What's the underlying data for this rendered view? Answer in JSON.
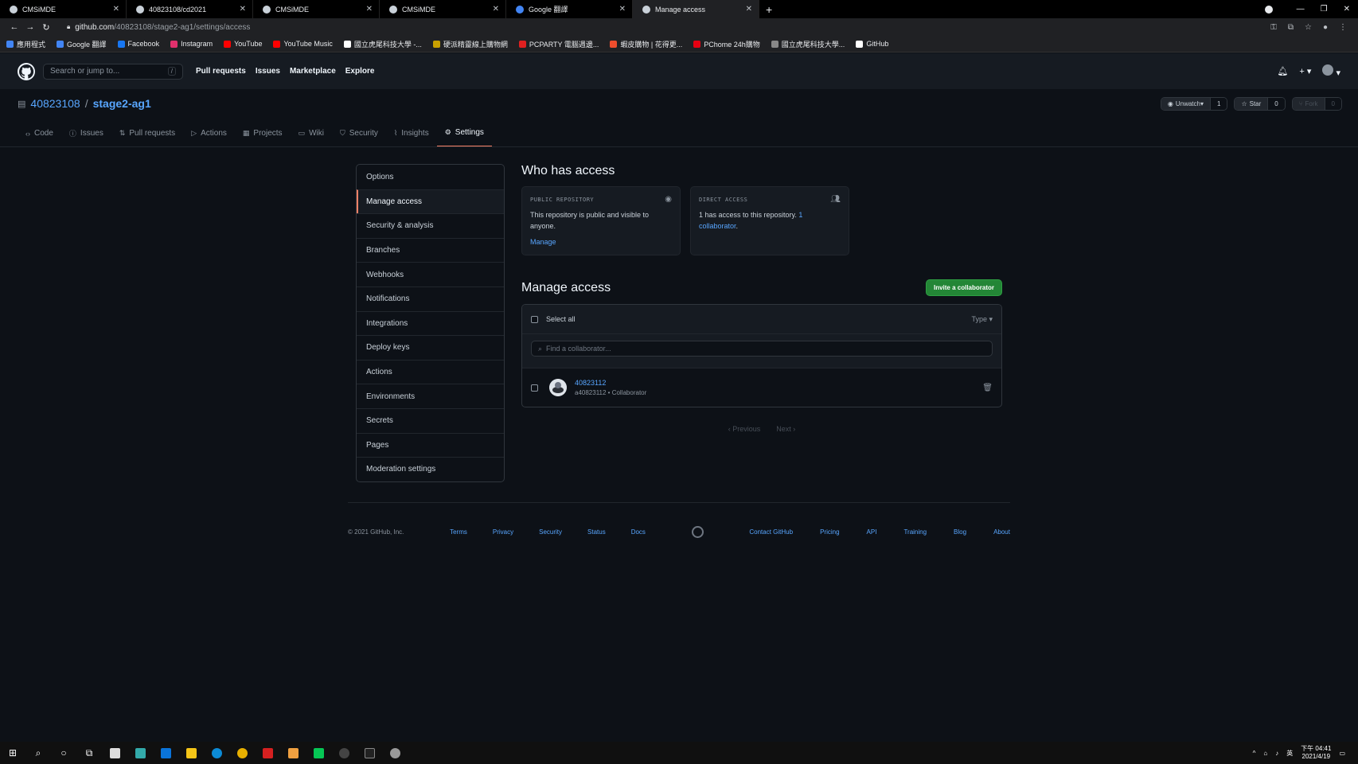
{
  "browser": {
    "tabs": [
      {
        "title": "CMSiMDE",
        "active": false
      },
      {
        "title": "40823108/cd2021",
        "active": false
      },
      {
        "title": "CMSiMDE",
        "active": false
      },
      {
        "title": "CMSiMDE",
        "active": false
      },
      {
        "title": "Google 翻譯",
        "active": false
      },
      {
        "title": "Manage access",
        "active": true
      }
    ],
    "new_tab": "+",
    "url_host": "github.com",
    "url_path": "/40823108/stage2-ag1/settings/access",
    "bookmarks": [
      {
        "label": "應用程式",
        "color": "#4285f4"
      },
      {
        "label": "Google 翻譯",
        "color": "#4285f4"
      },
      {
        "label": "Facebook",
        "color": "#1877f2"
      },
      {
        "label": "Instagram",
        "color": "#e1306c"
      },
      {
        "label": "YouTube",
        "color": "#ff0000"
      },
      {
        "label": "YouTube Music",
        "color": "#ff0000"
      },
      {
        "label": "國立虎尾科技大學 -...",
        "color": "#ffffff"
      },
      {
        "label": "硬派精靈線上購物網",
        "color": "#c8a000"
      },
      {
        "label": "PCPARTY 電腦週邊...",
        "color": "#e02020"
      },
      {
        "label": "蝦皮購物 | 花得更...",
        "color": "#ee4d2d"
      },
      {
        "label": "PChome 24h購物",
        "color": "#e60012"
      },
      {
        "label": "國立虎尾科技大學...",
        "color": "#888888"
      },
      {
        "label": "GitHub",
        "color": "#ffffff"
      }
    ]
  },
  "gh": {
    "search_placeholder": "Search or jump to...",
    "slash": "/",
    "nav": [
      "Pull requests",
      "Issues",
      "Marketplace",
      "Explore"
    ],
    "owner": "40823108",
    "repo": "stage2-ag1",
    "repo_sep": "/",
    "unwatch": "Unwatch",
    "unwatch_count": "1",
    "star": "Star",
    "star_count": "0",
    "fork": "Fork",
    "fork_count": "0",
    "tabs": [
      "Code",
      "Issues",
      "Pull requests",
      "Actions",
      "Projects",
      "Wiki",
      "Security",
      "Insights",
      "Settings"
    ],
    "active_tab": "Settings"
  },
  "sidebar": {
    "items": [
      "Options",
      "Manage access",
      "Security & analysis",
      "Branches",
      "Webhooks",
      "Notifications",
      "Integrations",
      "Deploy keys",
      "Actions",
      "Environments",
      "Secrets",
      "Pages",
      "Moderation settings"
    ],
    "active": "Manage access"
  },
  "main": {
    "who_title": "Who has access",
    "public_label": "PUBLIC REPOSITORY",
    "public_text": "This repository is public and visible to anyone.",
    "manage_link": "Manage",
    "direct_label": "DIRECT ACCESS",
    "direct_text": "1 has access to this repository.",
    "direct_link": "1 collaborator",
    "direct_dot": ".",
    "manage_title": "Manage access",
    "invite_button": "Invite a collaborator",
    "select_all": "Select all",
    "type_filter": "Type ▾",
    "find_placeholder": "Find a collaborator...",
    "collaborators": [
      {
        "name": "40823112",
        "sub": "a40823112 • Collaborator"
      }
    ],
    "previous": "‹ Previous",
    "next": "Next ›"
  },
  "footer": {
    "copyright": "© 2021 GitHub, Inc.",
    "left_links": [
      "Terms",
      "Privacy",
      "Security",
      "Status",
      "Docs"
    ],
    "right_links": [
      "Contact GitHub",
      "Pricing",
      "API",
      "Training",
      "Blog",
      "About"
    ]
  },
  "taskbar": {
    "time": "下午 04:41",
    "date": "2021/4/19",
    "ime": "英"
  }
}
